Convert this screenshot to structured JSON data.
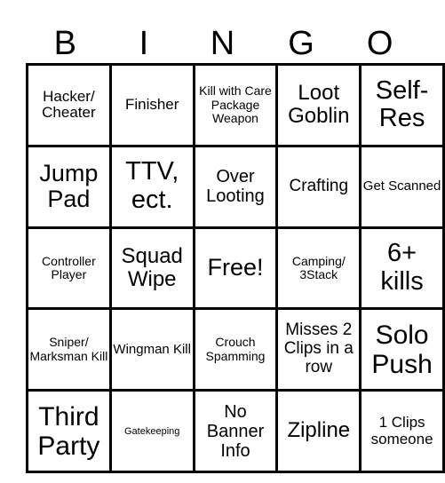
{
  "header": [
    "B",
    "I",
    "N",
    "G",
    "O"
  ],
  "rows": [
    [
      "Hacker/ Cheater",
      "Finisher",
      "Kill with Care Package Weapon",
      "Loot Goblin",
      "Self-Res"
    ],
    [
      "Jump Pad",
      "TTV, ect.",
      "Over Looting",
      "Crafting",
      "Get Scanned"
    ],
    [
      "Controller Player",
      "Squad Wipe",
      "Free!",
      "Camping/ 3Stack",
      "6+ kills"
    ],
    [
      "Sniper/ Marksman Kill",
      "Wingman Kill",
      "Crouch Spamming",
      "Misses 2 Clips in a row",
      "Solo Push"
    ],
    [
      "Third Party",
      "Gatekeeping",
      "No Banner Info",
      "Zipline",
      "1 Clips someone"
    ]
  ]
}
